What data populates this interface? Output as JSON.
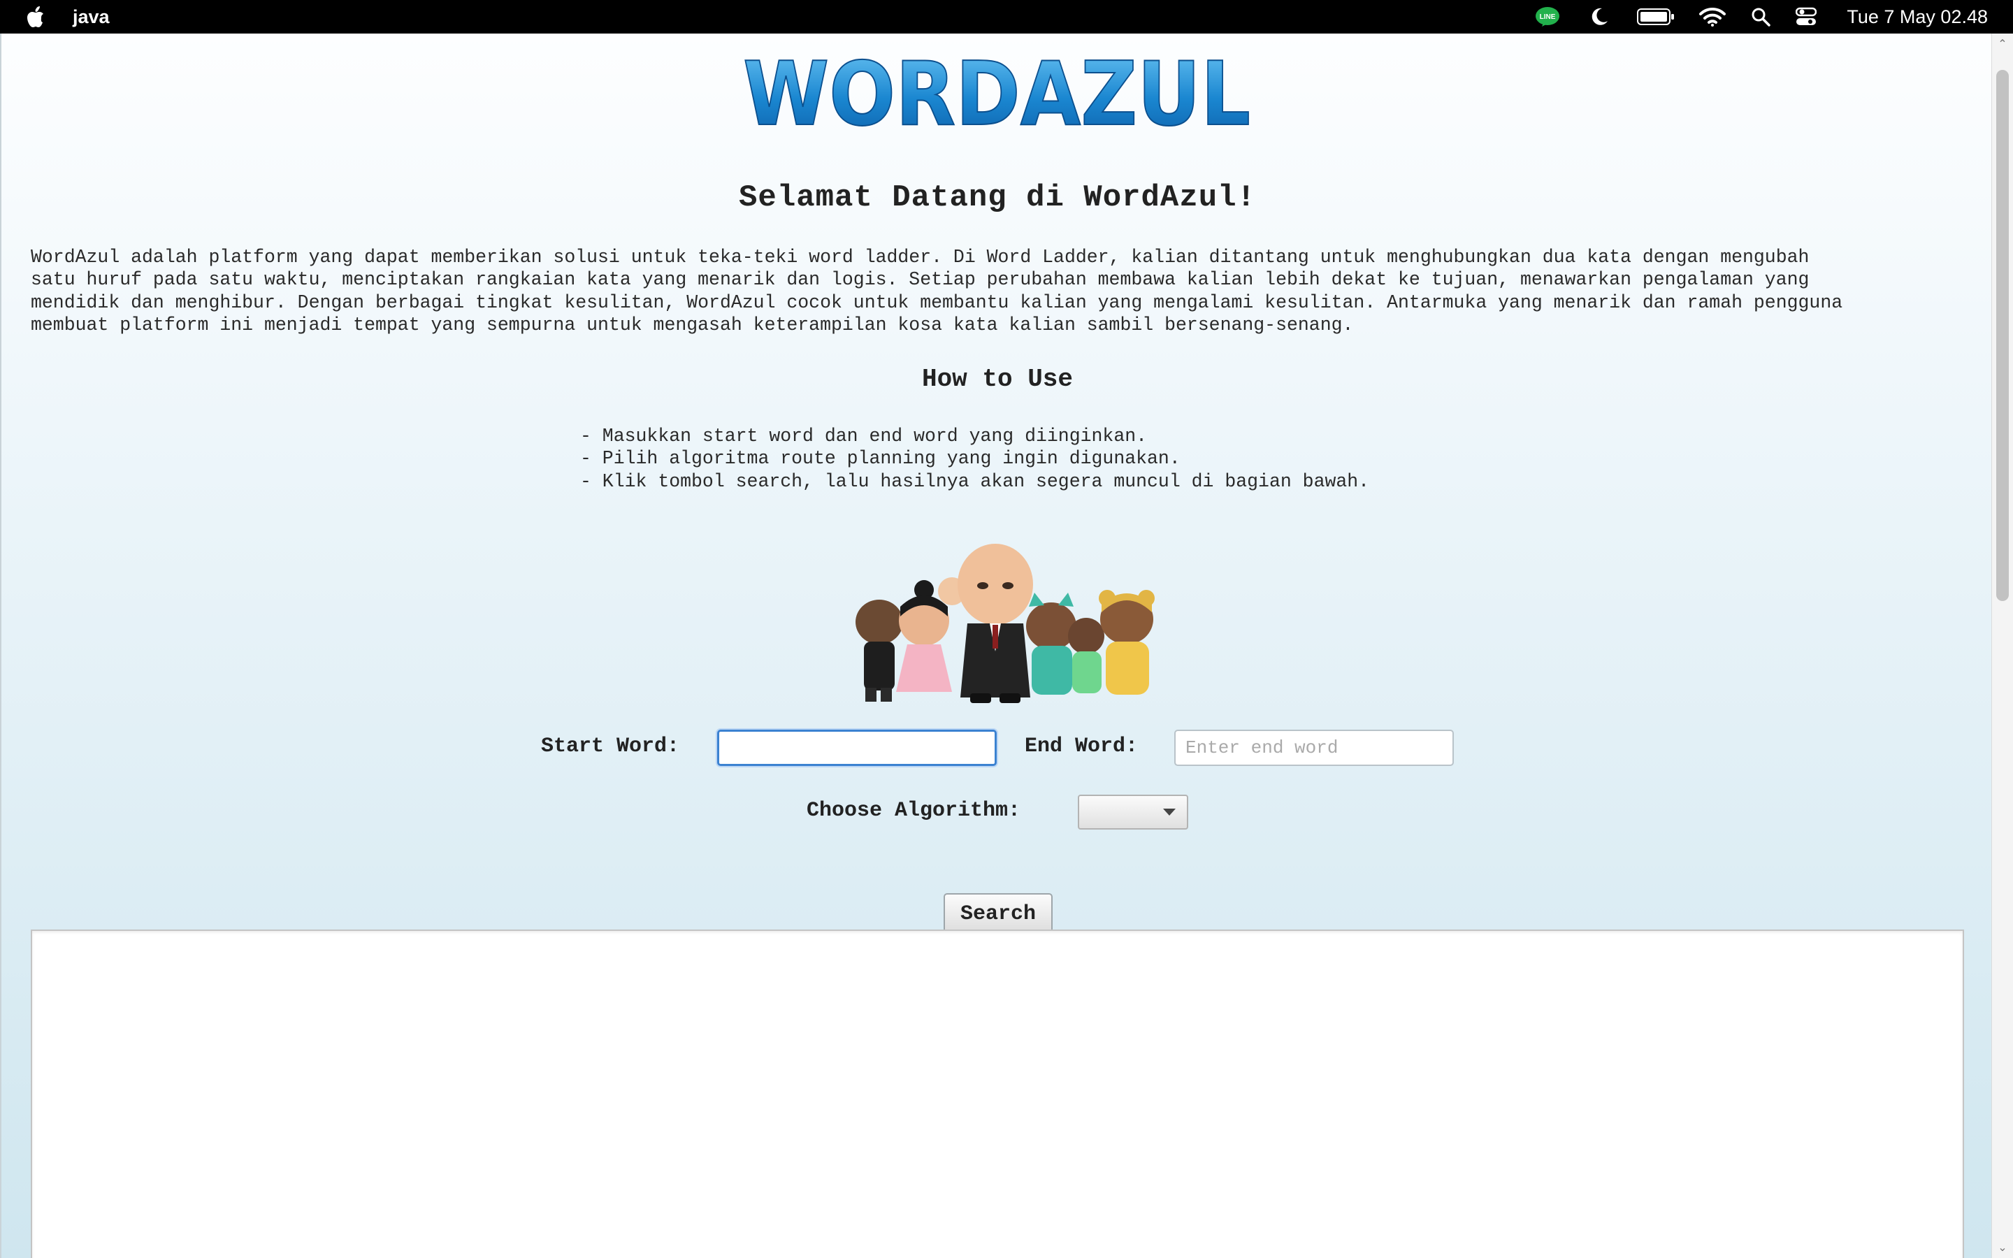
{
  "menubar": {
    "app_name": "java",
    "clock": "Tue 7 May  02.48",
    "icons": [
      "apple-logo-icon",
      "line-app-icon",
      "moon-icon",
      "battery-icon",
      "wifi-icon",
      "search-icon",
      "control-center-icon"
    ],
    "line_badge_text": "LINE"
  },
  "page": {
    "logo_text": "WORDAZUL",
    "welcome_title": "Selamat Datang di WordAzul!",
    "intro_lines": [
      "WordAzul adalah platform yang dapat memberikan solusi untuk teka-teki word ladder. Di Word Ladder, kalian ditantang untuk menghubungkan dua kata dengan mengubah",
      "satu huruf pada satu waktu, menciptakan rangkaian kata yang menarik dan logis. Setiap perubahan membawa kalian lebih dekat ke tujuan, menawarkan pengalaman yang",
      "mendidik dan menghibur. Dengan berbagai tingkat kesulitan, WordAzul cocok untuk membantu kalian yang mengalami kesulitan. Antarmuka yang menarik dan ramah pengguna",
      "membuat platform ini menjadi tempat yang sempurna untuk mengasah keterampilan kosa kata kalian sambil bersenang-senang."
    ],
    "howto_title": "How to Use",
    "steps": [
      "- Masukkan start word dan end word yang diinginkan.",
      "- Pilih algoritma route planning yang ingin digunakan.",
      "- Klik tombol search, lalu hasilnya akan segera muncul di bagian bawah."
    ]
  },
  "form": {
    "start_label": "Start Word:",
    "start_value": "",
    "start_placeholder": "",
    "end_label": "End Word:",
    "end_value": "",
    "end_placeholder": "Enter end word",
    "algorithm_label": "Choose Algorithm:",
    "algorithm_selected": "",
    "search_label": "Search"
  },
  "result": {
    "text": ""
  },
  "colors": {
    "logo_blue": "#1a86d0",
    "focus_blue": "#3b82d1",
    "menubar_bg": "#000000",
    "line_green": "#22b14c"
  }
}
